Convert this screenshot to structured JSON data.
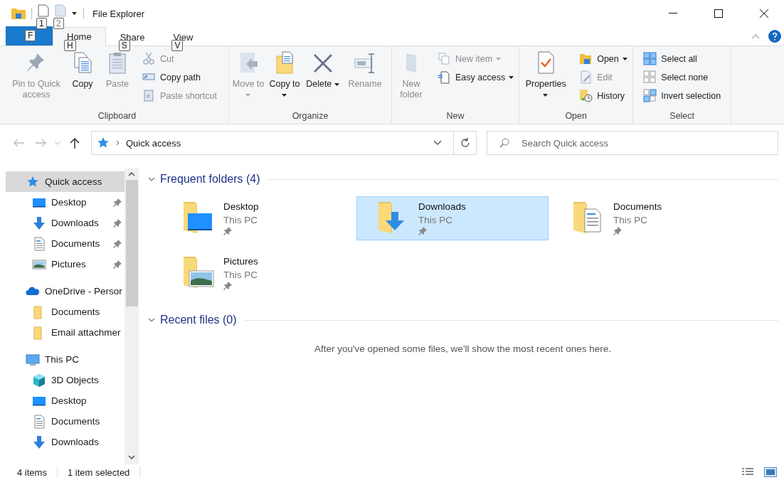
{
  "window": {
    "title": "File Explorer"
  },
  "quick_access_toolbar": {
    "keytips": [
      "1",
      "2"
    ]
  },
  "file_tab": {
    "keytip": "F"
  },
  "tabs": [
    {
      "label": "Home",
      "keytip": "H",
      "selected": true
    },
    {
      "label": "Share",
      "keytip": "S",
      "selected": false
    },
    {
      "label": "View",
      "keytip": "V",
      "selected": false
    }
  ],
  "ribbon": {
    "groups": [
      {
        "label": "Clipboard",
        "large": [
          {
            "label": "Pin to Quick access",
            "disabled": true,
            "dropdown": false
          },
          {
            "label": "Copy",
            "disabled": false,
            "dropdown": false
          },
          {
            "label": "Paste",
            "disabled": true,
            "dropdown": false
          }
        ],
        "small": [
          {
            "label": "Cut",
            "disabled": true,
            "dropdown": false
          },
          {
            "label": "Copy path",
            "disabled": false,
            "dropdown": false
          },
          {
            "label": "Paste shortcut",
            "disabled": true,
            "dropdown": false
          }
        ]
      },
      {
        "label": "Organize",
        "large": [
          {
            "label": "Move to",
            "disabled": true,
            "dropdown": true
          },
          {
            "label": "Copy to",
            "disabled": false,
            "dropdown": true
          },
          {
            "label": "Delete",
            "disabled": false,
            "dropdown": true
          },
          {
            "label": "Rename",
            "disabled": true,
            "dropdown": false
          }
        ]
      },
      {
        "label": "New",
        "large": [
          {
            "label": "New folder",
            "disabled": true,
            "dropdown": false
          }
        ],
        "small": [
          {
            "label": "New item",
            "disabled": true,
            "dropdown": true
          },
          {
            "label": "Easy access",
            "disabled": false,
            "dropdown": true
          }
        ]
      },
      {
        "label": "Open",
        "large": [
          {
            "label": "Properties",
            "disabled": false,
            "dropdown": true
          }
        ],
        "small": [
          {
            "label": "Open",
            "disabled": false,
            "dropdown": true
          },
          {
            "label": "Edit",
            "disabled": true,
            "dropdown": false
          },
          {
            "label": "History",
            "disabled": false,
            "dropdown": false
          }
        ]
      },
      {
        "label": "Select",
        "small": [
          {
            "label": "Select all",
            "disabled": false,
            "dropdown": false
          },
          {
            "label": "Select none",
            "disabled": false,
            "dropdown": false
          },
          {
            "label": "Invert selection",
            "disabled": false,
            "dropdown": false
          }
        ]
      }
    ]
  },
  "address_bar": {
    "path": "Quick access",
    "search_placeholder": "Search Quick access"
  },
  "navigation": [
    {
      "label": "Quick access",
      "kind": "star",
      "selected": true,
      "children": [
        {
          "label": "Desktop",
          "kind": "desktop",
          "selected": false,
          "pinned": true
        },
        {
          "label": "Downloads",
          "kind": "downloads",
          "selected": false,
          "pinned": true
        },
        {
          "label": "Documents",
          "kind": "documents",
          "selected": false,
          "pinned": true
        },
        {
          "label": "Pictures",
          "kind": "pictures",
          "selected": false,
          "pinned": true
        }
      ]
    },
    {
      "label": "OneDrive - Persor",
      "kind": "cloud",
      "selected": false,
      "children": [
        {
          "label": "Documents",
          "kind": "folder",
          "selected": false,
          "pinned": false
        },
        {
          "label": "Email attachmer",
          "kind": "folder",
          "selected": false,
          "pinned": false
        }
      ]
    },
    {
      "label": "This PC",
      "kind": "pc",
      "selected": false,
      "children": [
        {
          "label": "3D Objects",
          "kind": "objects",
          "selected": false,
          "pinned": false
        },
        {
          "label": "Desktop",
          "kind": "desktop",
          "selected": false,
          "pinned": false
        },
        {
          "label": "Documents",
          "kind": "documents",
          "selected": false,
          "pinned": false
        },
        {
          "label": "Downloads",
          "kind": "downloads",
          "selected": false,
          "pinned": false
        }
      ]
    }
  ],
  "sections": [
    {
      "title": "Frequent folders (4)",
      "expanded": true,
      "items": [
        {
          "name": "Desktop",
          "location": "This PC",
          "kind": "desktop",
          "pinned": true,
          "selected": false
        },
        {
          "name": "Downloads",
          "location": "This PC",
          "kind": "downloads",
          "pinned": true,
          "selected": true
        },
        {
          "name": "Documents",
          "location": "This PC",
          "kind": "documents",
          "pinned": true,
          "selected": false
        },
        {
          "name": "Pictures",
          "location": "This PC",
          "kind": "pictures",
          "pinned": true,
          "selected": false
        }
      ]
    },
    {
      "title": "Recent files (0)",
      "expanded": true,
      "message": "After you've opened some files, we'll show the most recent ones here."
    }
  ],
  "status_bar": {
    "item_count": "4 items",
    "selection": "1 item selected"
  }
}
